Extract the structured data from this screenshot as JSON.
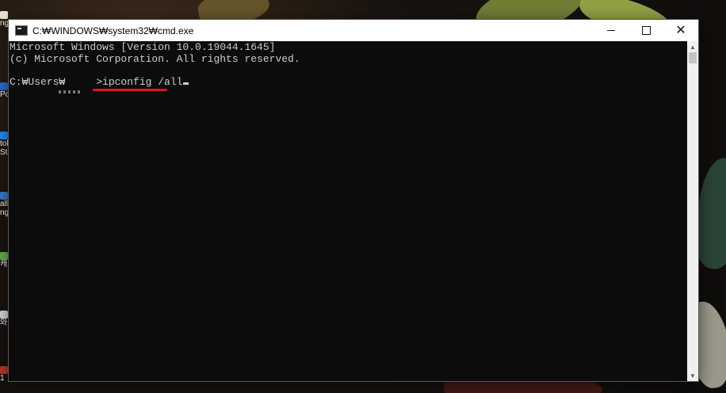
{
  "window": {
    "title": "C:₩WINDOWS₩system32₩cmd.exe",
    "icon": "cmd-icon"
  },
  "console": {
    "lines": [
      "Microsoft Windows [Version 10.0.19044.1645]",
      "(c) Microsoft Corporation. All rights reserved."
    ],
    "prompt": "C:₩Users₩     >",
    "command": "ipconfig /all"
  },
  "desktop": {
    "icons": [
      "ng",
      "Po",
      "tob",
      "Stu",
      "allp",
      "ng",
      "캐",
      "와",
      "1"
    ]
  },
  "colors": {
    "console_bg": "#0c0c0c",
    "console_text": "#cccccc",
    "highlight_underline": "#e1141e"
  }
}
